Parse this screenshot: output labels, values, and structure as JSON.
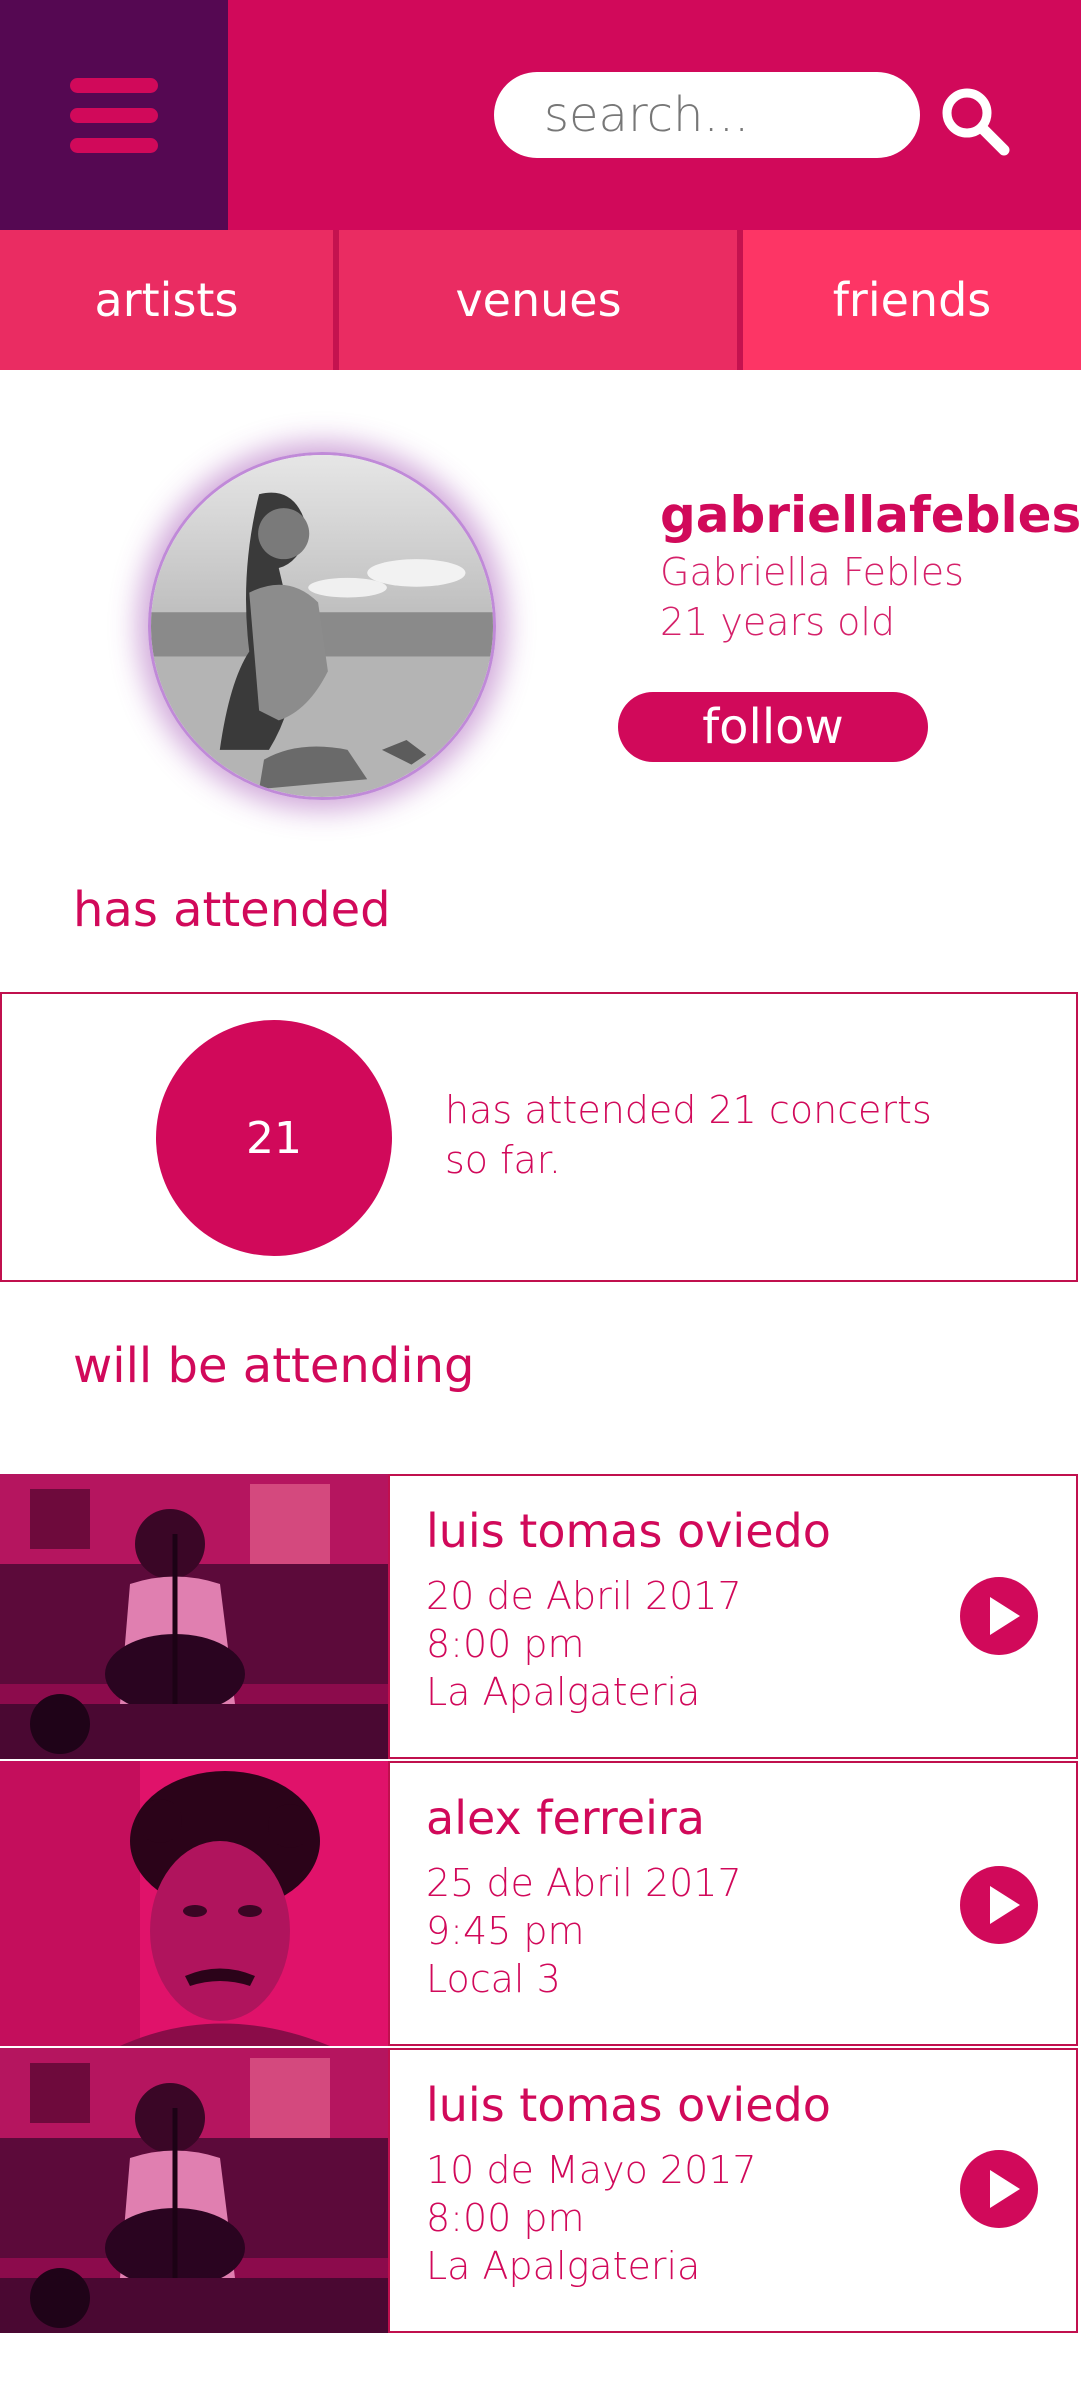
{
  "header": {
    "search_placeholder": "search...",
    "menu_icon": "hamburger-menu-icon",
    "search_icon": "search-icon"
  },
  "tabs": [
    {
      "label": "artists"
    },
    {
      "label": "venues"
    },
    {
      "label": "friends"
    }
  ],
  "profile": {
    "username": "gabriellafebles",
    "full_name": "Gabriella Febles",
    "age": "21 years old",
    "follow_label": "follow"
  },
  "attended": {
    "section_title": "has attended",
    "count": "21",
    "description": "has attended 21 concerts so far."
  },
  "upcoming": {
    "section_title": "will be attending",
    "events": [
      {
        "artist": "luis tomas oviedo",
        "date": "20 de Abril 2017",
        "time": "8:00 pm",
        "venue": "La Apalgateria"
      },
      {
        "artist": "alex ferreira",
        "date": "25 de Abril 2017",
        "time": "9:45 pm",
        "venue": "Local 3"
      },
      {
        "artist": "luis tomas oviedo",
        "date": "10 de Mayo 2017",
        "time": "8:00 pm",
        "venue": "La Apalgateria"
      }
    ]
  },
  "colors": {
    "primary": "#d1095a",
    "menu_bg": "#550852",
    "tab_bg": "#ea2c62",
    "tab_active_bg": "#fd3565"
  }
}
